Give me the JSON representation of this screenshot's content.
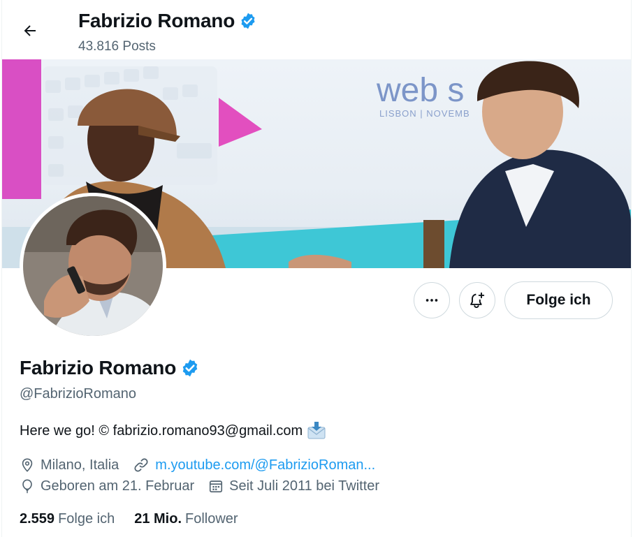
{
  "header": {
    "name": "Fabrizio Romano",
    "posts": "43.816 Posts"
  },
  "banner": {
    "text_web": "web s",
    "text_location": "LISBON | NOVEMB"
  },
  "actions": {
    "follow_label": "Folge ich"
  },
  "profile": {
    "name": "Fabrizio Romano",
    "handle": "@FabrizioRomano",
    "bio": "Here we go! © fabrizio.romano93@gmail.com",
    "location": "Milano, Italia",
    "website": "m.youtube.com/@FabrizioRoman...",
    "birthday": "Geboren am 21. Februar",
    "joined": "Seit Juli 2011 bei Twitter"
  },
  "stats": {
    "following_count": "2.559",
    "following_label": "Folge ich",
    "followers_count": "21 Mio.",
    "followers_label": "Follower"
  },
  "colors": {
    "verified": "#1d9bf0",
    "link": "#1d9bf0",
    "secondary_text": "#536471",
    "border": "#cfd9de"
  },
  "icons": [
    "back-arrow-icon",
    "verified-badge-icon",
    "more-icon",
    "notification-bell-plus-icon",
    "envelope-download-icon",
    "location-icon",
    "link-icon",
    "balloon-icon",
    "calendar-icon"
  ]
}
